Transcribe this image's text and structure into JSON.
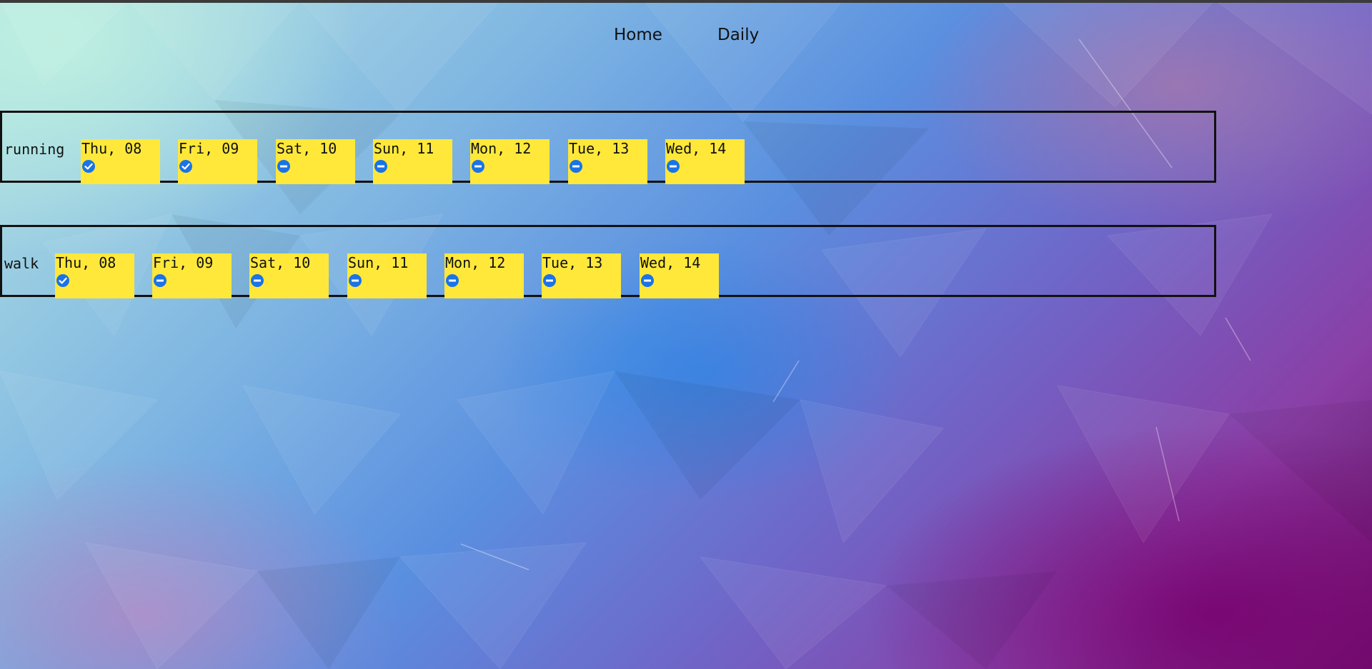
{
  "nav": {
    "home_label": "Home",
    "daily_label": "Daily"
  },
  "theme": {
    "day_bg": "#ffe83a",
    "status_icon_color": "#1a73e8",
    "border_color": "#111111"
  },
  "habits": [
    {
      "name": "running",
      "days": [
        {
          "label": "Thu, 08",
          "status": "done",
          "icon": "check-circle-icon"
        },
        {
          "label": "Fri, 09",
          "status": "done",
          "icon": "check-circle-icon"
        },
        {
          "label": "Sat, 10",
          "status": "skipped",
          "icon": "minus-circle-icon"
        },
        {
          "label": "Sun, 11",
          "status": "skipped",
          "icon": "minus-circle-icon"
        },
        {
          "label": "Mon, 12",
          "status": "skipped",
          "icon": "minus-circle-icon"
        },
        {
          "label": "Tue, 13",
          "status": "skipped",
          "icon": "minus-circle-icon"
        },
        {
          "label": "Wed, 14",
          "status": "skipped",
          "icon": "minus-circle-icon"
        }
      ]
    },
    {
      "name": "walk",
      "days": [
        {
          "label": "Thu, 08",
          "status": "done",
          "icon": "check-circle-icon"
        },
        {
          "label": "Fri, 09",
          "status": "skipped",
          "icon": "minus-circle-icon"
        },
        {
          "label": "Sat, 10",
          "status": "skipped",
          "icon": "minus-circle-icon"
        },
        {
          "label": "Sun, 11",
          "status": "skipped",
          "icon": "minus-circle-icon"
        },
        {
          "label": "Mon, 12",
          "status": "skipped",
          "icon": "minus-circle-icon"
        },
        {
          "label": "Tue, 13",
          "status": "skipped",
          "icon": "minus-circle-icon"
        },
        {
          "label": "Wed, 14",
          "status": "skipped",
          "icon": "minus-circle-icon"
        }
      ]
    }
  ]
}
